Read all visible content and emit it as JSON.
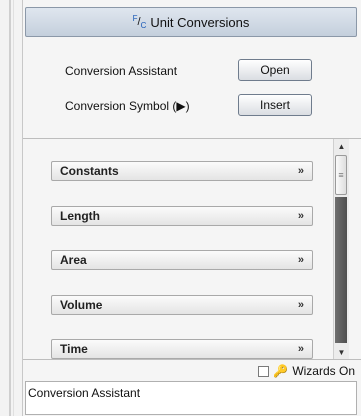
{
  "header": {
    "title": "Unit Conversions",
    "icon": "unit-conversions-icon"
  },
  "tools": [
    {
      "label": "Conversion Assistant",
      "button": "Open"
    },
    {
      "label": "Conversion Symbol (▶)",
      "button": "Insert"
    }
  ],
  "categories": [
    {
      "label": "Constants"
    },
    {
      "label": "Length"
    },
    {
      "label": "Area"
    },
    {
      "label": "Volume"
    },
    {
      "label": "Time"
    }
  ],
  "wizards": {
    "label": "Wizards On",
    "checked": false
  },
  "description": "Conversion Assistant"
}
